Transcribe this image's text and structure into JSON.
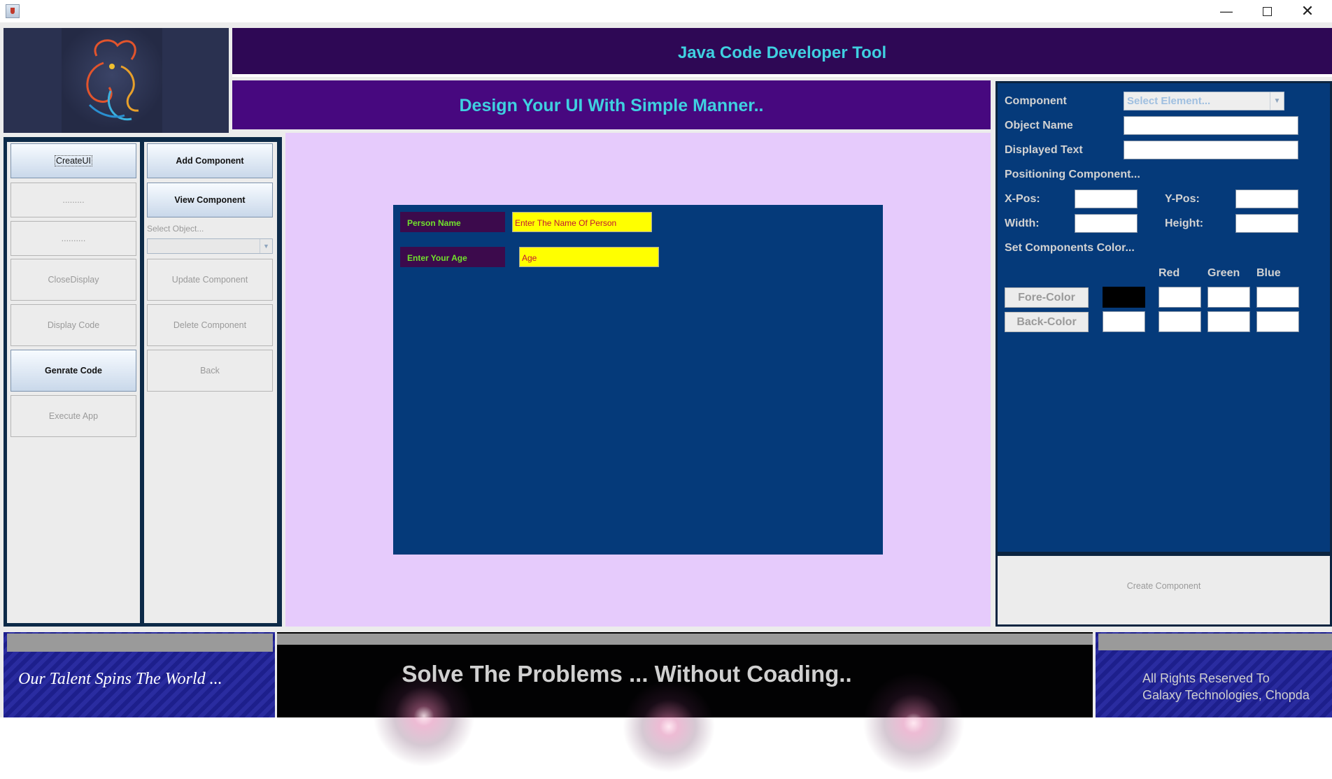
{
  "window": {
    "minimize": "—",
    "close": "✕"
  },
  "header": {
    "title": "Java Code Developer Tool",
    "subtitle": "Design Your UI With Simple Manner.."
  },
  "left_panel": {
    "col1": [
      "CreateUI",
      ".........",
      "..........",
      "CloseDisplay",
      "Display Code",
      "Genrate Code",
      "Execute App"
    ],
    "col2": [
      "Add Component",
      "View Component",
      "Update Component",
      "Delete Component",
      "Back"
    ],
    "select_object_label": "Select Object...",
    "select_object_value": ""
  },
  "canvas": {
    "label1": "Person Name",
    "field1": "Enter The Name Of Person",
    "label2": "Enter Your Age",
    "field2": "Age"
  },
  "properties": {
    "component_label": "Component",
    "component_placeholder": "Select Element...",
    "object_name_label": "Object Name",
    "object_name_value": "",
    "displayed_text_label": "Displayed Text",
    "displayed_text_value": "",
    "positioning_label": "Positioning Component...",
    "xpos_label": "X-Pos:",
    "ypos_label": "Y-Pos:",
    "width_label": "Width:",
    "height_label": "Height:",
    "color_section_label": "Set Components Color...",
    "red_label": "Red",
    "green_label": "Green",
    "blue_label": "Blue",
    "fore_color_button": "Fore-Color",
    "back_color_button": "Back-Color",
    "fore_color_swatch": "#000000",
    "back_color_swatch": "#ffffff",
    "create_component_button": "Create Component"
  },
  "footer": {
    "left_text": "Our Talent Spins The World ...",
    "center_text": "Solve The Problems ... Without Coading..",
    "right_line1": "All Rights Reserved To",
    "right_line2": "Galaxy Technologies, Chopda"
  },
  "colors": {
    "header_dark": "#2e0855",
    "header_purple": "#47087f",
    "header_text": "#3fd0e0",
    "design_area": "#e6cbfc",
    "canvas_blue": "#053a7a",
    "label_green": "#71e22c",
    "field_yellow": "#ffff00"
  }
}
